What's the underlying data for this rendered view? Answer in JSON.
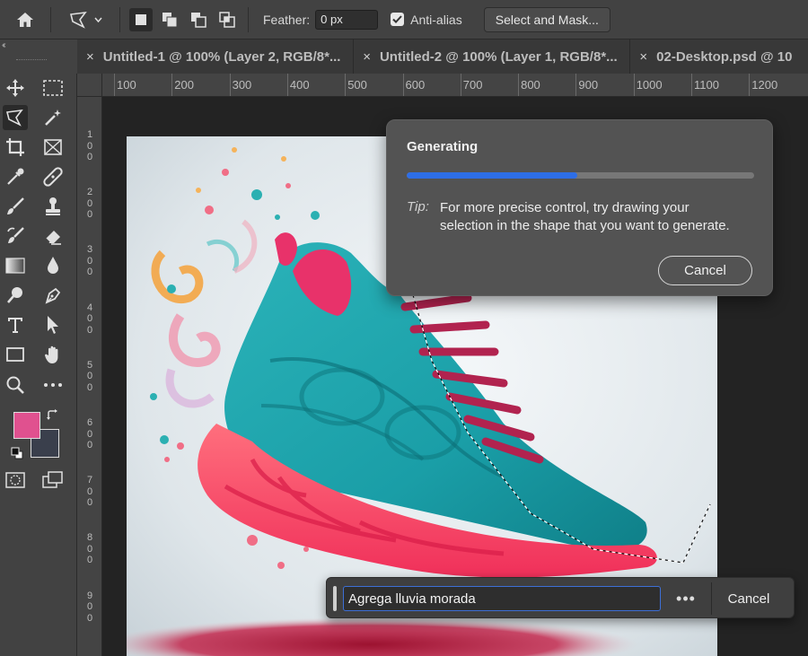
{
  "options_bar": {
    "home_icon": "home-icon",
    "feather_label": "Feather:",
    "feather_value": "0 px",
    "antialias_label": "Anti-alias",
    "antialias_checked": true,
    "select_mask_label": "Select and Mask..."
  },
  "panel": {
    "collapse_glyph": "‹‹"
  },
  "tabs": [
    {
      "close": "×",
      "label": "Untitled-1 @ 100% (Layer 2, RGB/8*..."
    },
    {
      "close": "×",
      "label": "Untitled-2 @ 100% (Layer 1, RGB/8*..."
    },
    {
      "close": "×",
      "label": "02-Desktop.psd @ 10"
    }
  ],
  "ruler_top": [
    "100",
    "200",
    "300",
    "400",
    "500",
    "600",
    "700",
    "800",
    "900",
    "1000",
    "1100",
    "1200"
  ],
  "ruler_left": [
    "1\n0\n0",
    "2\n0\n0",
    "3\n0\n0",
    "4\n0\n0",
    "5\n0\n0",
    "6\n0\n0",
    "7\n0\n0",
    "8\n0\n0",
    "9\n0\n0"
  ],
  "colors": {
    "foreground": "#e0518f",
    "background": "#3a3f4c",
    "accent": "#2e6ee6"
  },
  "generating": {
    "title": "Generating",
    "progress": 0.49,
    "tip_label": "Tip:",
    "tip_text": "For more precise control, try drawing your selection in the shape that you want to generate.",
    "cancel_label": "Cancel"
  },
  "taskbar": {
    "prompt_value": "Agrega lluvia morada",
    "more_label": "•••",
    "cancel_label": "Cancel"
  }
}
